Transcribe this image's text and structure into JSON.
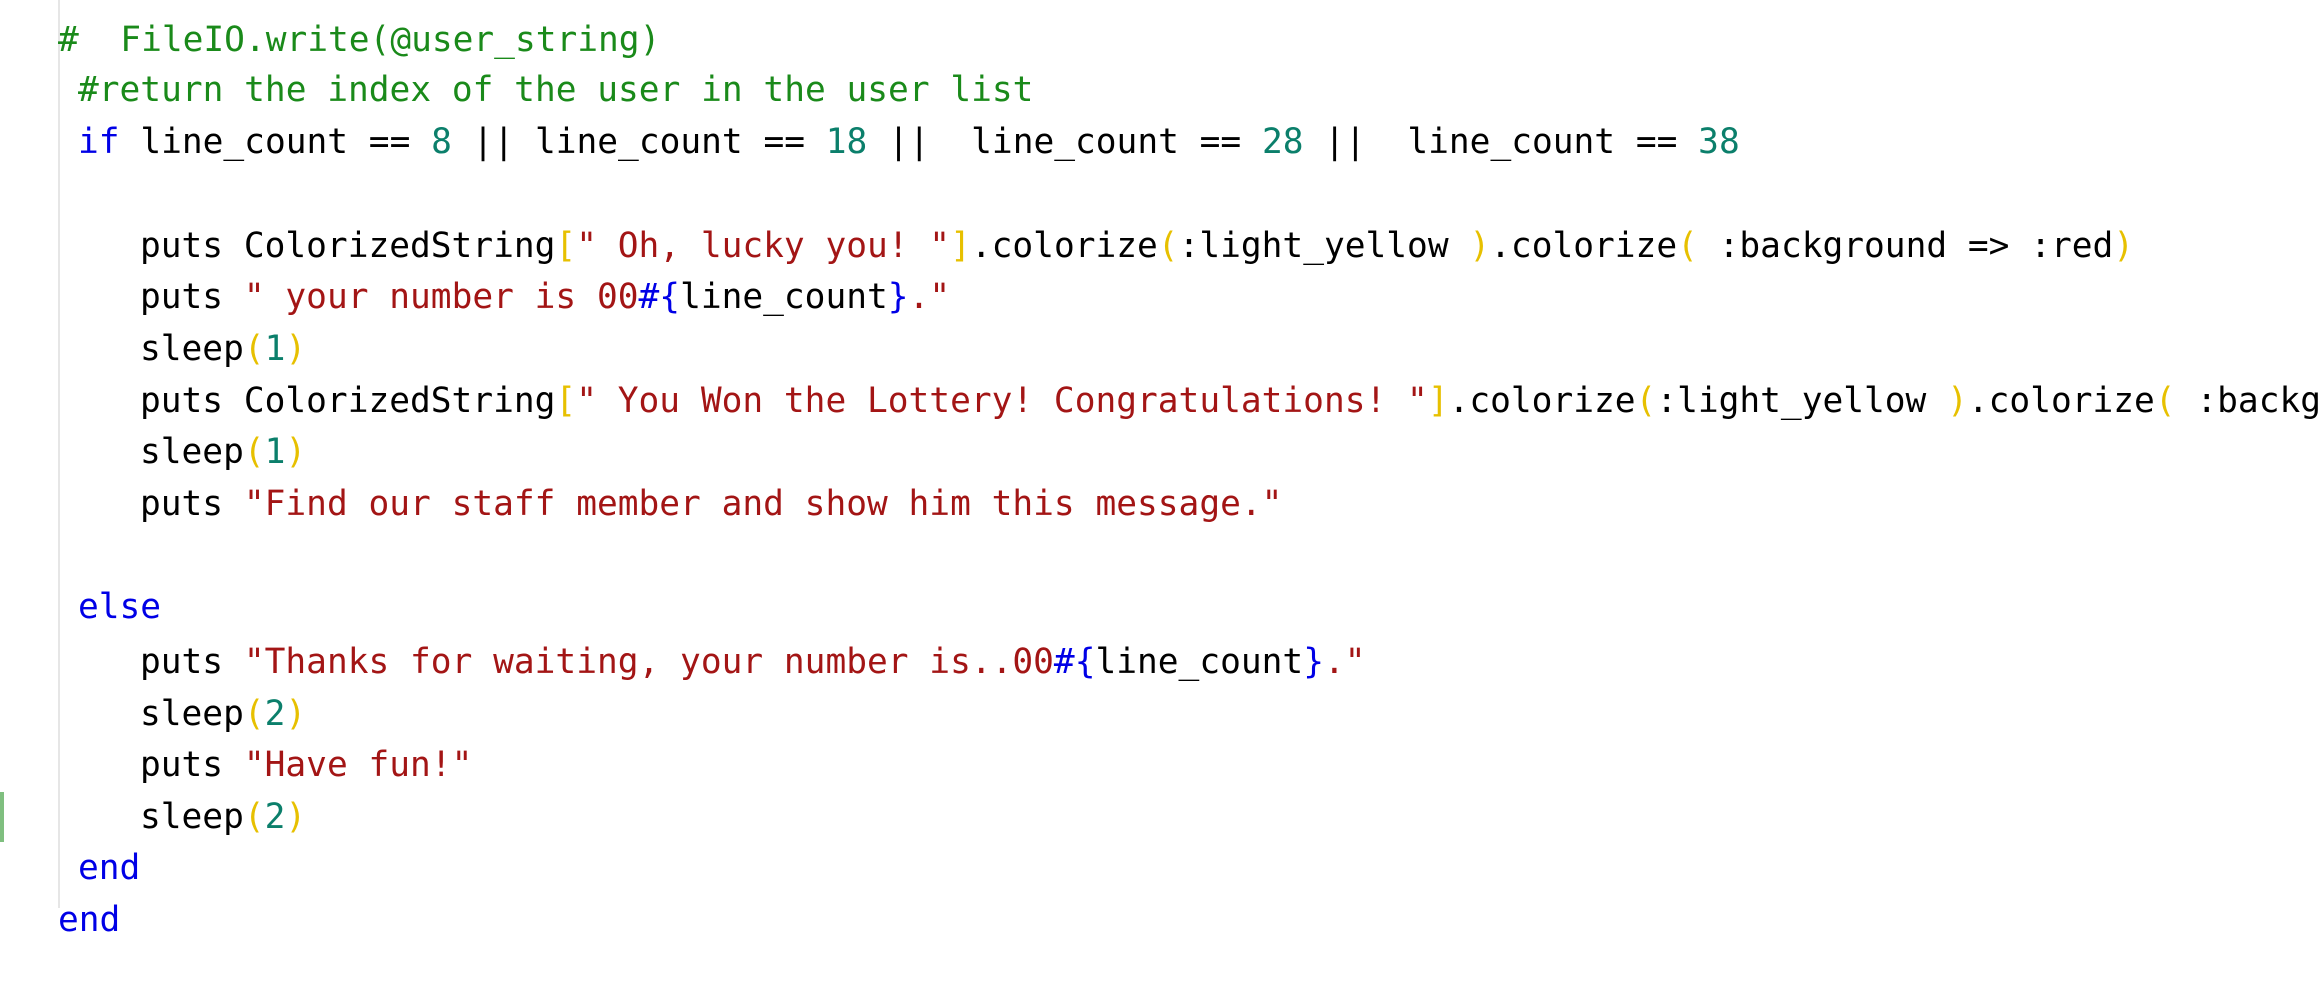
{
  "colors": {
    "comment": "#1a8a1a",
    "keyword": "#0000e6",
    "number": "#0b7f6b",
    "string": "#a31515",
    "bracket": "#e7c000",
    "plain": "#000000",
    "change_marker": "#7fbf7f"
  },
  "code": {
    "lines": [
      {
        "tokens": [
          {
            "t": "#  FileIO.write(@user_string)",
            "k": "comment"
          }
        ]
      },
      {
        "tokens": [
          {
            "t": "#return the index of the user in the user list",
            "k": "comment"
          }
        ]
      },
      {
        "tokens": [
          {
            "t": "if",
            "k": "kw"
          },
          {
            "t": " line_count == ",
            "k": "plain"
          },
          {
            "t": "8",
            "k": "num"
          },
          {
            "t": " || line_count == ",
            "k": "plain"
          },
          {
            "t": "18",
            "k": "num"
          },
          {
            "t": " ||  line_count == ",
            "k": "plain"
          },
          {
            "t": "28",
            "k": "num"
          },
          {
            "t": " ||  line_count == ",
            "k": "plain"
          },
          {
            "t": "38",
            "k": "num"
          }
        ]
      },
      {
        "tokens": []
      },
      {
        "tokens": [
          {
            "t": "puts ColorizedString",
            "k": "plain"
          },
          {
            "t": "[",
            "k": "br"
          },
          {
            "t": "\" Oh, lucky you! \"",
            "k": "str"
          },
          {
            "t": "]",
            "k": "br"
          },
          {
            "t": ".colorize",
            "k": "plain"
          },
          {
            "t": "(",
            "k": "br"
          },
          {
            "t": ":light_yellow ",
            "k": "plain"
          },
          {
            "t": ")",
            "k": "br"
          },
          {
            "t": ".colorize",
            "k": "plain"
          },
          {
            "t": "(",
            "k": "br"
          },
          {
            "t": " :background => :red",
            "k": "plain"
          },
          {
            "t": ")",
            "k": "br"
          }
        ]
      },
      {
        "tokens": [
          {
            "t": "puts ",
            "k": "plain"
          },
          {
            "t": "\" your number is 00",
            "k": "str"
          },
          {
            "t": "#{",
            "k": "kw"
          },
          {
            "t": "line_count",
            "k": "plain"
          },
          {
            "t": "}",
            "k": "kw"
          },
          {
            "t": ".\"",
            "k": "str"
          }
        ]
      },
      {
        "tokens": [
          {
            "t": "sleep",
            "k": "plain"
          },
          {
            "t": "(",
            "k": "br"
          },
          {
            "t": "1",
            "k": "num"
          },
          {
            "t": ")",
            "k": "br"
          }
        ]
      },
      {
        "tokens": [
          {
            "t": "puts ColorizedString",
            "k": "plain"
          },
          {
            "t": "[",
            "k": "br"
          },
          {
            "t": "\" You Won the Lottery! Congratulations! \"",
            "k": "str"
          },
          {
            "t": "]",
            "k": "br"
          },
          {
            "t": ".colorize",
            "k": "plain"
          },
          {
            "t": "(",
            "k": "br"
          },
          {
            "t": ":light_yellow ",
            "k": "plain"
          },
          {
            "t": ")",
            "k": "br"
          },
          {
            "t": ".colorize",
            "k": "plain"
          },
          {
            "t": "(",
            "k": "br"
          },
          {
            "t": " :backg",
            "k": "plain"
          }
        ]
      },
      {
        "tokens": [
          {
            "t": "sleep",
            "k": "plain"
          },
          {
            "t": "(",
            "k": "br"
          },
          {
            "t": "1",
            "k": "num"
          },
          {
            "t": ")",
            "k": "br"
          }
        ]
      },
      {
        "tokens": [
          {
            "t": "puts ",
            "k": "plain"
          },
          {
            "t": "\"Find our staff member and show him this message.\"",
            "k": "str"
          }
        ]
      },
      {
        "tokens": []
      },
      {
        "tokens": [
          {
            "t": "else",
            "k": "kw"
          }
        ]
      },
      {
        "tokens": [
          {
            "t": "puts ",
            "k": "plain"
          },
          {
            "t": "\"Thanks for waiting, your number is..00",
            "k": "str"
          },
          {
            "t": "#{",
            "k": "kw"
          },
          {
            "t": "line_count",
            "k": "plain"
          },
          {
            "t": "}",
            "k": "kw"
          },
          {
            "t": ".\"",
            "k": "str"
          }
        ]
      },
      {
        "tokens": [
          {
            "t": "sleep",
            "k": "plain"
          },
          {
            "t": "(",
            "k": "br"
          },
          {
            "t": "2",
            "k": "num"
          },
          {
            "t": ")",
            "k": "br"
          }
        ]
      },
      {
        "tokens": [
          {
            "t": "puts ",
            "k": "plain"
          },
          {
            "t": "\"Have fun!\"",
            "k": "str"
          }
        ]
      },
      {
        "tokens": [
          {
            "t": "sleep",
            "k": "plain"
          },
          {
            "t": "(",
            "k": "br"
          },
          {
            "t": "2",
            "k": "num"
          },
          {
            "t": ")",
            "k": "br"
          }
        ]
      },
      {
        "tokens": [
          {
            "t": "end",
            "k": "kw"
          }
        ]
      },
      {
        "tokens": [
          {
            "t": "end",
            "k": "kw"
          }
        ]
      }
    ]
  }
}
